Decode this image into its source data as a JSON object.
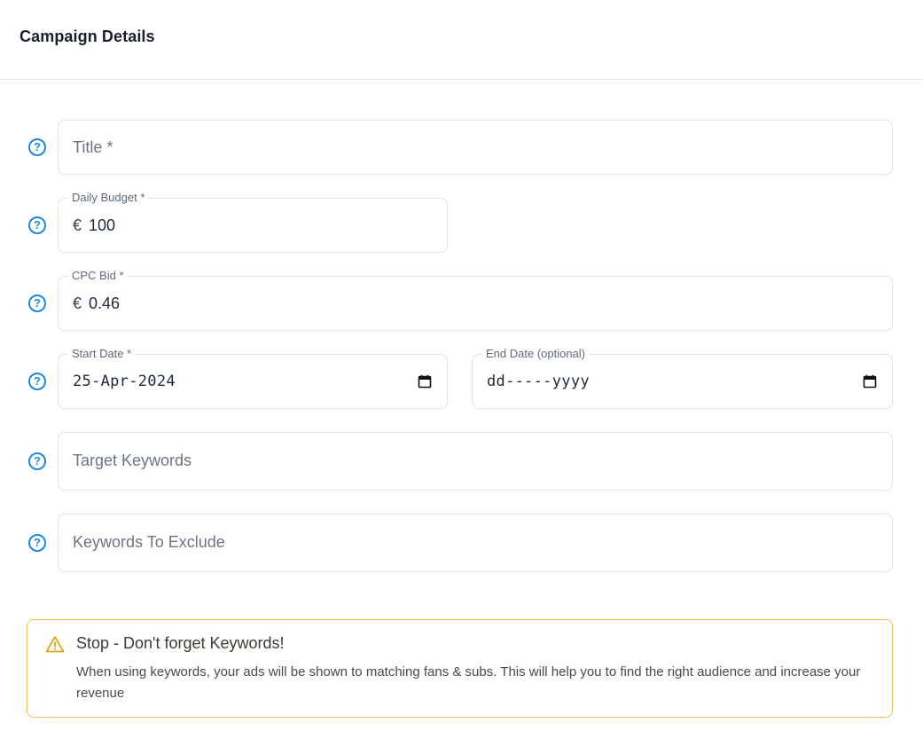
{
  "header": {
    "title": "Campaign Details"
  },
  "form": {
    "title": {
      "placeholder": "Title *"
    },
    "daily_budget": {
      "label": "Daily Budget *",
      "currency": "€",
      "value": "100"
    },
    "cpc_bid": {
      "label": "CPC Bid *",
      "currency": "€",
      "value": "0.46"
    },
    "start_date": {
      "label": "Start Date *",
      "value": "25-Apr-2024"
    },
    "end_date": {
      "label": "End Date (optional)",
      "value": "dd-----yyyy"
    },
    "target_keywords": {
      "placeholder": "Target Keywords"
    },
    "exclude_keywords": {
      "placeholder": "Keywords To Exclude"
    },
    "help_glyph": "?"
  },
  "alert": {
    "title": "Stop - Don't forget Keywords!",
    "body": "When using keywords, your ads will be shown to matching fans & subs. This will help you to find the right audience and increase your revenue"
  },
  "colors": {
    "accent": "#1e88e5",
    "warning_border": "#f2c14e",
    "warning_icon": "#e0a61a"
  }
}
